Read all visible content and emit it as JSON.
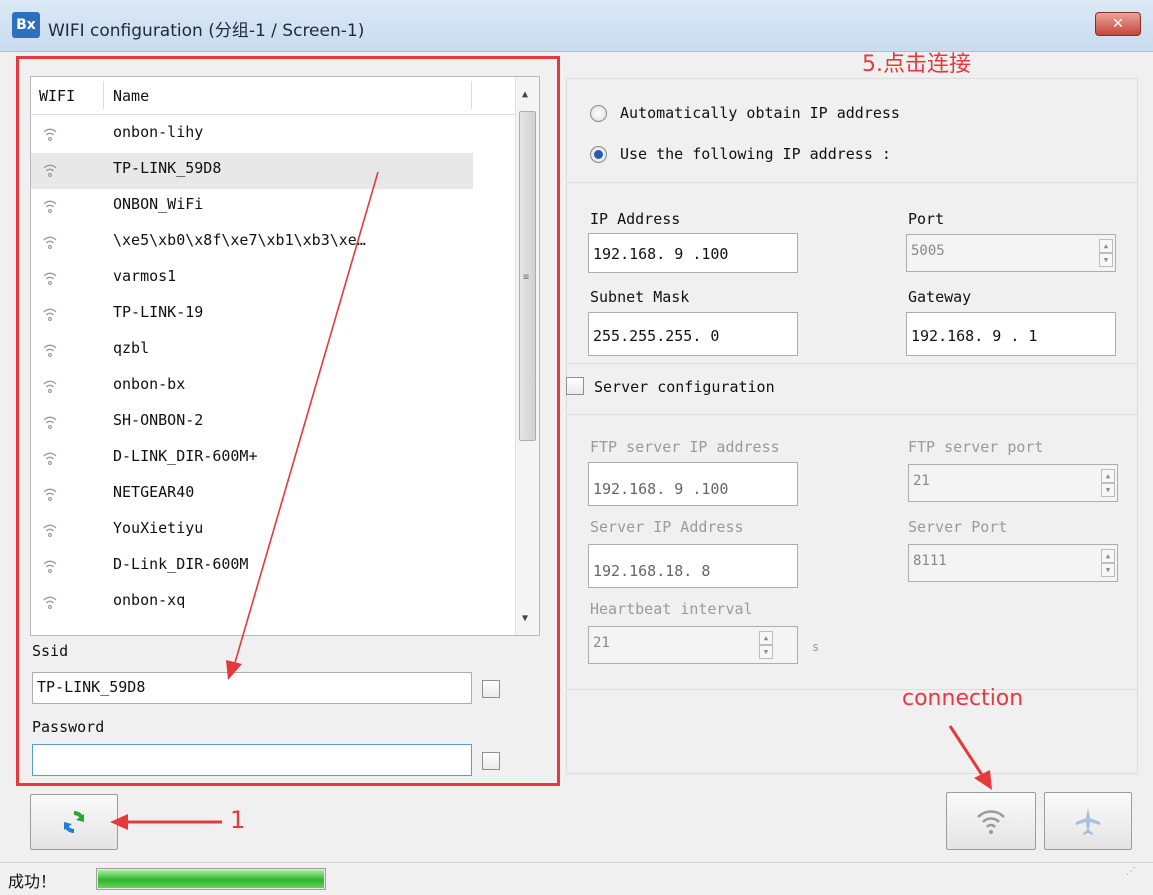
{
  "window": {
    "title": "WIFI configuration  (分组-1 / Screen-1)",
    "icon_label": "Bx",
    "close_label": "✕"
  },
  "wifi_list": {
    "columns": [
      "WIFI",
      "Name"
    ],
    "rows": [
      {
        "name": "onbon-lihy"
      },
      {
        "name": "TP-LINK_59D8",
        "selected": true
      },
      {
        "name": "ONBON_WiFi"
      },
      {
        "name": "  \\xe5\\xb0\\x8f\\xe7\\xb1\\xb3\\xe…"
      },
      {
        "name": "varmos1"
      },
      {
        "name": "TP-LINK-19"
      },
      {
        "name": "qzbl"
      },
      {
        "name": "onbon-bx"
      },
      {
        "name": "SH-ONBON-2"
      },
      {
        "name": "D-LINK_DIR-600M+"
      },
      {
        "name": "NETGEAR40"
      },
      {
        "name": "YouXietiyu"
      },
      {
        "name": "D-Link_DIR-600M"
      },
      {
        "name": "onbon-xq"
      }
    ]
  },
  "ssid": {
    "label": "Ssid",
    "value": "TP-LINK_59D8"
  },
  "password": {
    "label": "Password",
    "value": ""
  },
  "ip_mode": {
    "auto_label": "Automatically obtain IP address",
    "manual_label": "Use the following IP address :",
    "selected": "manual"
  },
  "ip": {
    "address_label": "IP Address",
    "address": "192.168. 9 .100",
    "port_label": "Port",
    "port": "5005",
    "mask_label": "Subnet Mask",
    "mask": "255.255.255. 0",
    "gateway_label": "Gateway",
    "gateway": "192.168. 9 . 1"
  },
  "server": {
    "checkbox_label": "Server configuration",
    "ftp_ip_label": "FTP server IP address",
    "ftp_ip": "192.168. 9 .100",
    "ftp_port_label": "FTP server port",
    "ftp_port": "21",
    "server_ip_label": "Server IP Address",
    "server_ip": "192.168.18. 8",
    "server_port_label": "Server Port",
    "server_port": "8111",
    "heartbeat_label": "Heartbeat interval",
    "heartbeat": "21",
    "heartbeat_unit": "s"
  },
  "annotations": {
    "step5": "5.点击连接",
    "connection": "connection",
    "step1": "1"
  },
  "status": {
    "text": "成功！",
    "progress": 1.0
  },
  "colors": {
    "annotation": "#e6393d",
    "progress": "#2fb52f"
  }
}
